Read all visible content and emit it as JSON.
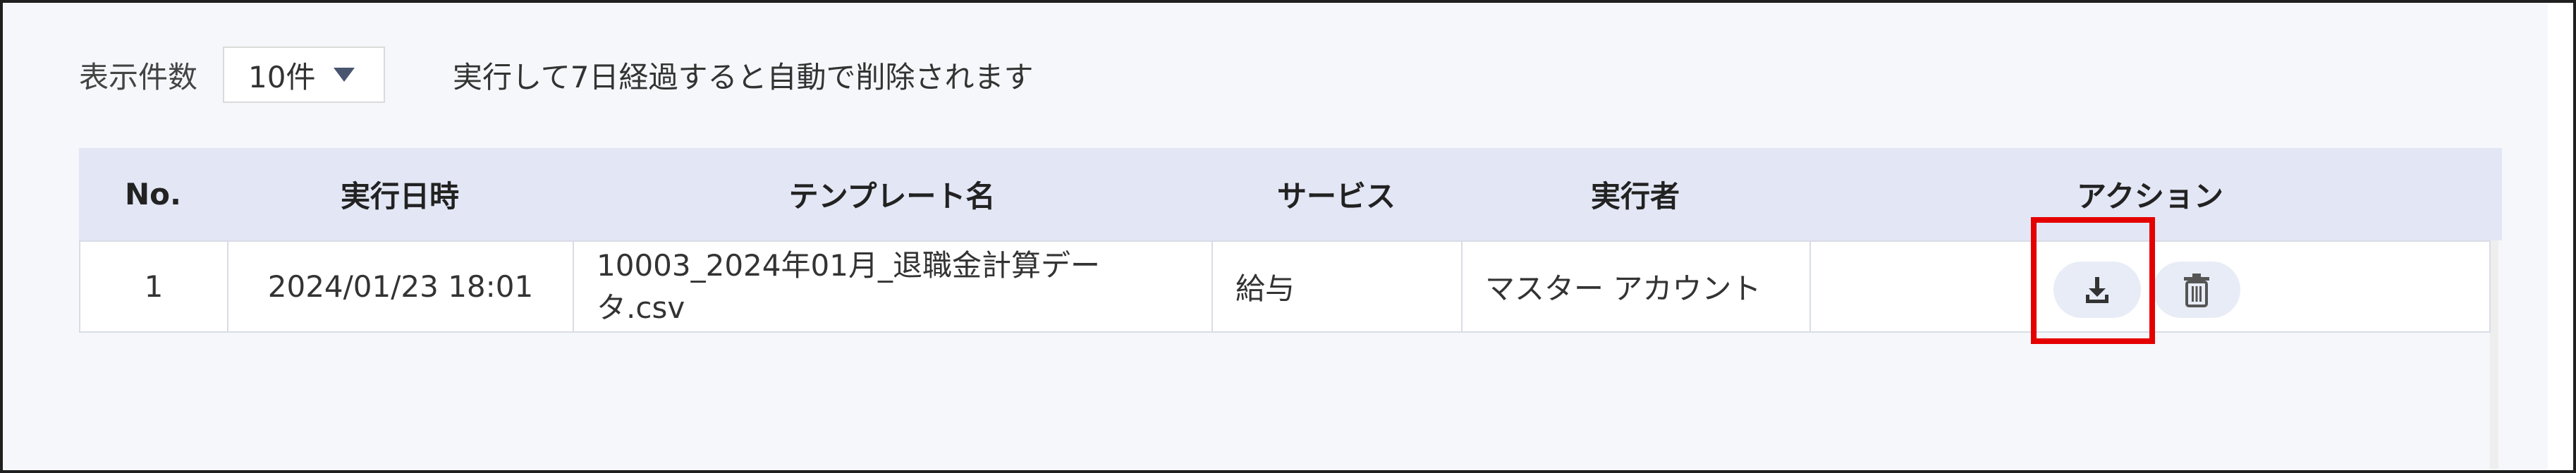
{
  "toolbar": {
    "display_count_label": "表示件数",
    "display_count_value": "10件",
    "auto_delete_note": "実行して7日経過すると自動で削除されます"
  },
  "table": {
    "headers": {
      "no": "No.",
      "executed_at": "実行日時",
      "template_name": "テンプレート名",
      "service": "サービス",
      "executor": "実行者",
      "action": "アクション"
    },
    "rows": [
      {
        "no": "1",
        "executed_at": "2024/01/23 18:01",
        "template_name": "10003_2024年01月_退職金計算データ.csv",
        "service": "給与",
        "executor": "マスター アカウント"
      }
    ]
  },
  "icons": {
    "download": "download-icon",
    "delete": "trash-icon",
    "dropdown": "caret-down-icon"
  },
  "colors": {
    "header_bg": "#e3e6f4",
    "action_button_bg": "#e8ecf6",
    "highlight": "#e50000",
    "caret": "#4a5570"
  }
}
